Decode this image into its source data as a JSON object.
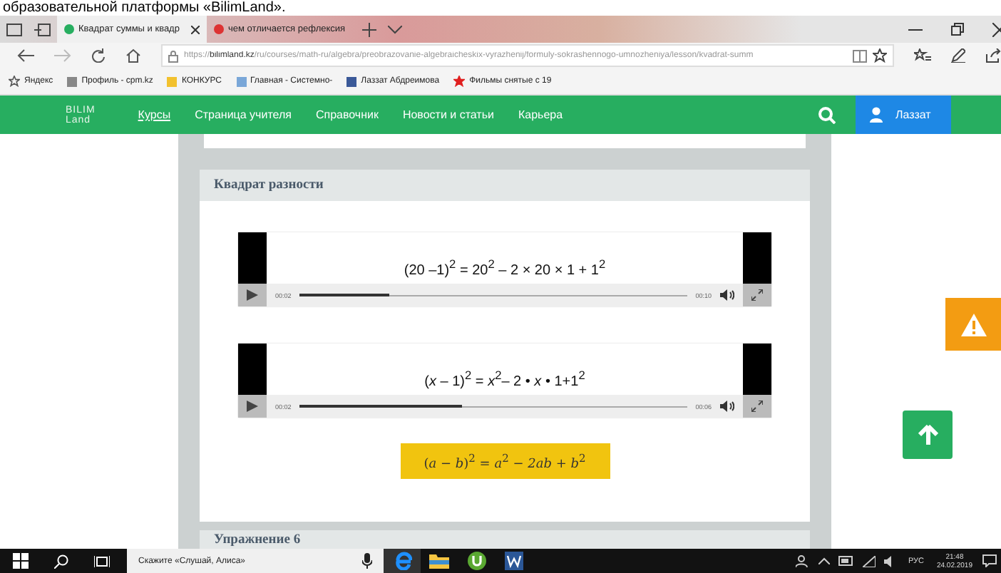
{
  "caption": "образовательной платформы «BilimLand».",
  "browser": {
    "tabs": [
      {
        "title": "Квадрат суммы и квадр",
        "selected": true
      },
      {
        "title": "чем отличается рефлексия",
        "selected": false
      }
    ],
    "url": "https://**bilimland.kz**/ru/courses/math-ru/algebra/preobrazovanie-algebraicheskix-vyrazhenij/formuly-sokrashennogo-umnozheniya/lesson/kvadrat-summ",
    "bookmarks": [
      {
        "label": "Яндекс",
        "kind": "star"
      },
      {
        "label": "Профиль - cpm.kz",
        "kind": "page"
      },
      {
        "label": "КОНКУРС",
        "kind": "folder"
      },
      {
        "label": "Главная - Системно-",
        "kind": "doc"
      },
      {
        "label": "Лаззат Абдреимова",
        "kind": "facebook"
      },
      {
        "label": "Фильмы снятые с 19",
        "kind": "redstar"
      }
    ]
  },
  "site": {
    "logo": [
      "BILIM",
      "Land"
    ],
    "nav": [
      {
        "label": "Курсы",
        "selected": true
      },
      {
        "label": "Страница учителя",
        "selected": false
      },
      {
        "label": "Справочник",
        "selected": false
      },
      {
        "label": "Новости и статьи",
        "selected": false
      },
      {
        "label": "Карьера",
        "selected": false
      }
    ],
    "user": "Лаззат"
  },
  "section": {
    "title": "Квадрат разности",
    "players": [
      {
        "formula": "(20 –1)$^{2}$ = 20$^{2}$ – 2 × 20 × 1 + 1$^{2}$",
        "current": "00:02",
        "duration": "00:10",
        "level": 0.23
      },
      {
        "formula": "(*x* – 1)$^{2}$ = *x*$^{2}$– 2 • *x* • 1+1$^{2}$",
        "current": "00:02",
        "duration": "00:06",
        "level": 0.42
      }
    ],
    "rule": "(*a* − *b*)$^{2}$ = *a*$^{2}$ − *2ab* + *b*$^{2}$"
  },
  "next_section": {
    "title": "Упражнение 6"
  },
  "taskbar": {
    "search": "Скажите «Слушай, Алиса»",
    "language": "РУС",
    "time": "21:48",
    "date": "24.02.2019"
  }
}
